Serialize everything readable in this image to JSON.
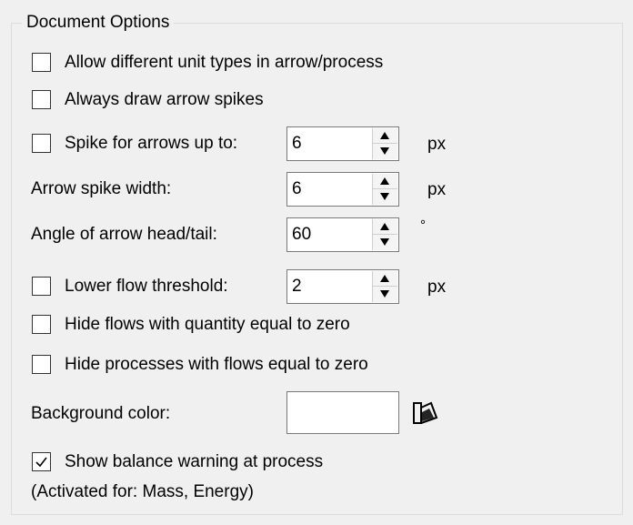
{
  "group": {
    "title": "Document Options"
  },
  "options": {
    "allow_unit_types": {
      "label": "Allow different unit types in arrow/process",
      "checked": false
    },
    "always_draw_spikes": {
      "label": "Always draw arrow spikes",
      "checked": false
    },
    "spike_for_arrows": {
      "label": "Spike for arrows up to:",
      "checked": false,
      "value": "6",
      "unit": "px"
    },
    "arrow_spike_width": {
      "label": "Arrow spike width:",
      "value": "6",
      "unit": "px"
    },
    "arrow_head_angle": {
      "label": "Angle of arrow head/tail:",
      "value": "60",
      "unit": "°"
    },
    "lower_flow_threshold": {
      "label": "Lower flow threshold:",
      "checked": false,
      "value": "2",
      "unit": "px"
    },
    "hide_zero_flows": {
      "label": "Hide flows with quantity equal to zero",
      "checked": false
    },
    "hide_zero_processes": {
      "label": "Hide processes with flows equal to zero",
      "checked": false
    },
    "background_color": {
      "label": "Background color:",
      "color": "#ffffff",
      "picker_icon": "paint-bucket-icon"
    },
    "show_balance_warning": {
      "label": "Show balance warning at process",
      "checked": true
    },
    "activated_for": "(Activated for: Mass, Energy)"
  },
  "icons": {
    "spin_up": "up-arrow-icon",
    "spin_down": "down-arrow-icon",
    "check": "checkmark-icon"
  }
}
